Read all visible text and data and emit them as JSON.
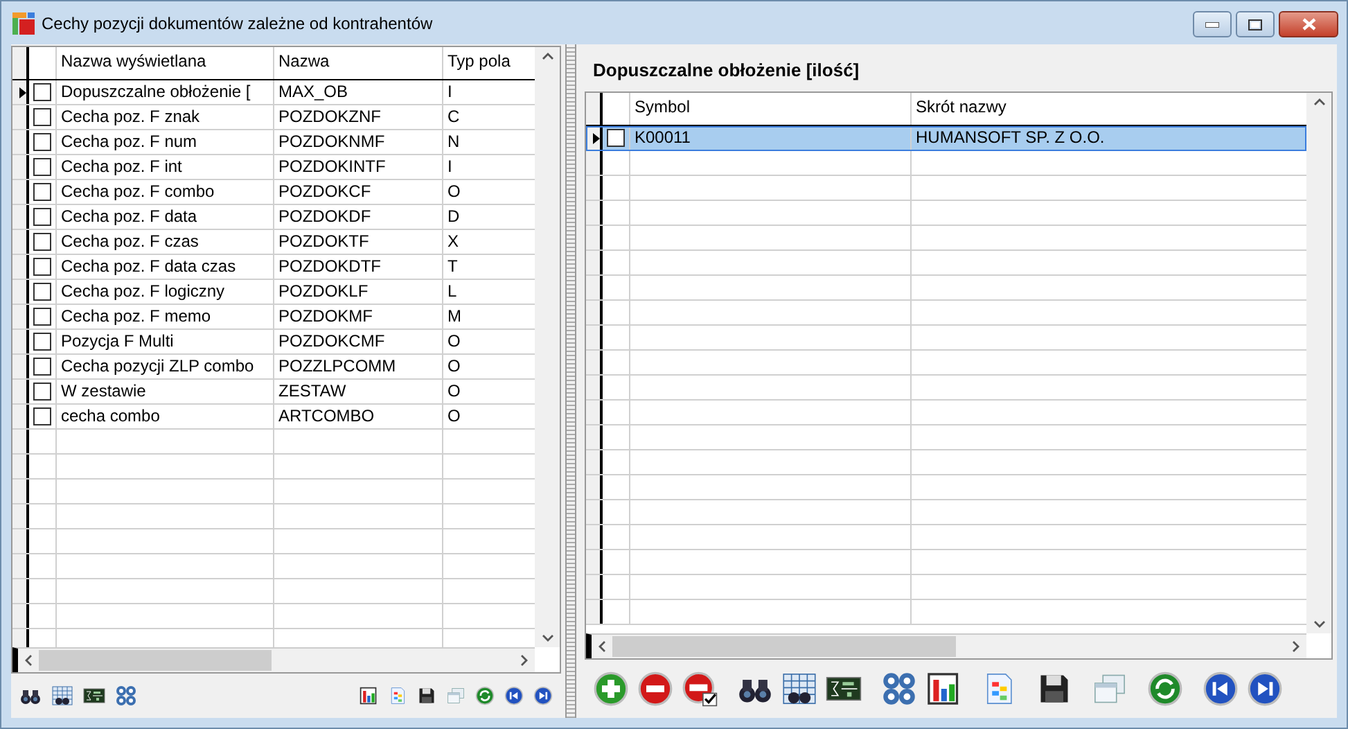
{
  "window": {
    "title": "Cechy pozycji dokumentów zależne od kontrahentów"
  },
  "left_grid": {
    "columns": [
      "Nazwa wyświetlana",
      "Nazwa",
      "Typ pola"
    ],
    "rows": [
      {
        "display_name": "Dopuszczalne obłożenie [",
        "name": "MAX_OB",
        "type": "I",
        "checked": false,
        "current": true
      },
      {
        "display_name": "Cecha poz. F znak",
        "name": "POZDOKZNF",
        "type": "C",
        "checked": false,
        "current": false
      },
      {
        "display_name": "Cecha poz. F num",
        "name": "POZDOKNMF",
        "type": "N",
        "checked": false,
        "current": false
      },
      {
        "display_name": "Cecha poz. F int",
        "name": "POZDOKINTF",
        "type": "I",
        "checked": false,
        "current": false
      },
      {
        "display_name": "Cecha poz. F combo",
        "name": "POZDOKCF",
        "type": "O",
        "checked": false,
        "current": false
      },
      {
        "display_name": "Cecha poz. F data",
        "name": "POZDOKDF",
        "type": "D",
        "checked": false,
        "current": false
      },
      {
        "display_name": "Cecha poz. F czas",
        "name": "POZDOKTF",
        "type": "X",
        "checked": false,
        "current": false
      },
      {
        "display_name": "Cecha poz. F data czas",
        "name": "POZDOKDTF",
        "type": "T",
        "checked": false,
        "current": false
      },
      {
        "display_name": "Cecha poz. F logiczny",
        "name": "POZDOKLF",
        "type": "L",
        "checked": false,
        "current": false
      },
      {
        "display_name": "Cecha poz. F memo",
        "name": "POZDOKMF",
        "type": "M",
        "checked": false,
        "current": false
      },
      {
        "display_name": "Pozycja F Multi",
        "name": "POZDOKCMF",
        "type": "O",
        "checked": false,
        "current": false
      },
      {
        "display_name": "Cecha pozycji ZLP combo",
        "name": "POZZLPCOMM",
        "type": "O",
        "checked": false,
        "current": false
      },
      {
        "display_name": "W zestawie",
        "name": "ZESTAW",
        "type": "O",
        "checked": false,
        "current": false
      },
      {
        "display_name": "cecha  combo",
        "name": "ARTCOMBO",
        "type": "O",
        "checked": false,
        "current": false
      }
    ]
  },
  "right_panel": {
    "title": "Dopuszczalne obłożenie [ilość]",
    "columns": [
      "Symbol",
      "Skrót nazwy"
    ],
    "rows": [
      {
        "symbol": "K00011",
        "short_name": "HUMANSOFT SP. Z O.O.",
        "checked": false,
        "current": true,
        "selected": true
      }
    ]
  }
}
